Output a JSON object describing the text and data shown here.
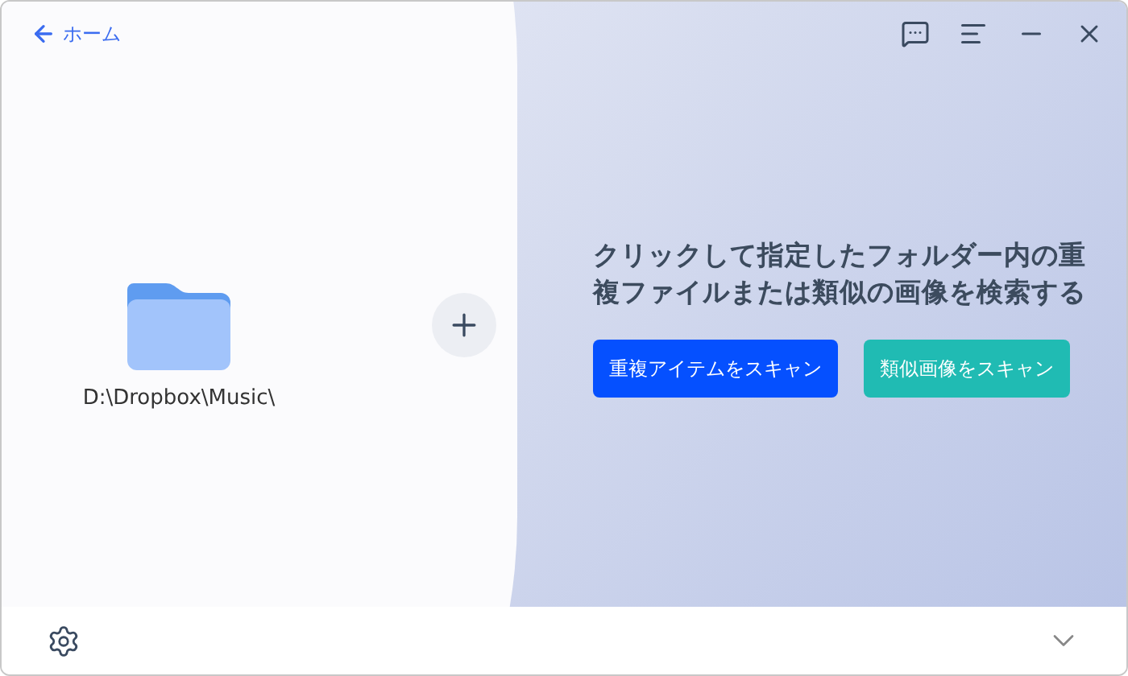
{
  "header": {
    "back_label": "ホーム"
  },
  "folder": {
    "path": "D:\\Dropbox\\Music\\"
  },
  "prompt": "クリックして指定したフォルダー内の重複ファイルまたは類似の画像を検索する",
  "buttons": [
    {
      "label": "重複アイテムをスキャン",
      "kind": "primary"
    },
    {
      "label": "類似画像をスキャン",
      "kind": "secondary"
    }
  ]
}
